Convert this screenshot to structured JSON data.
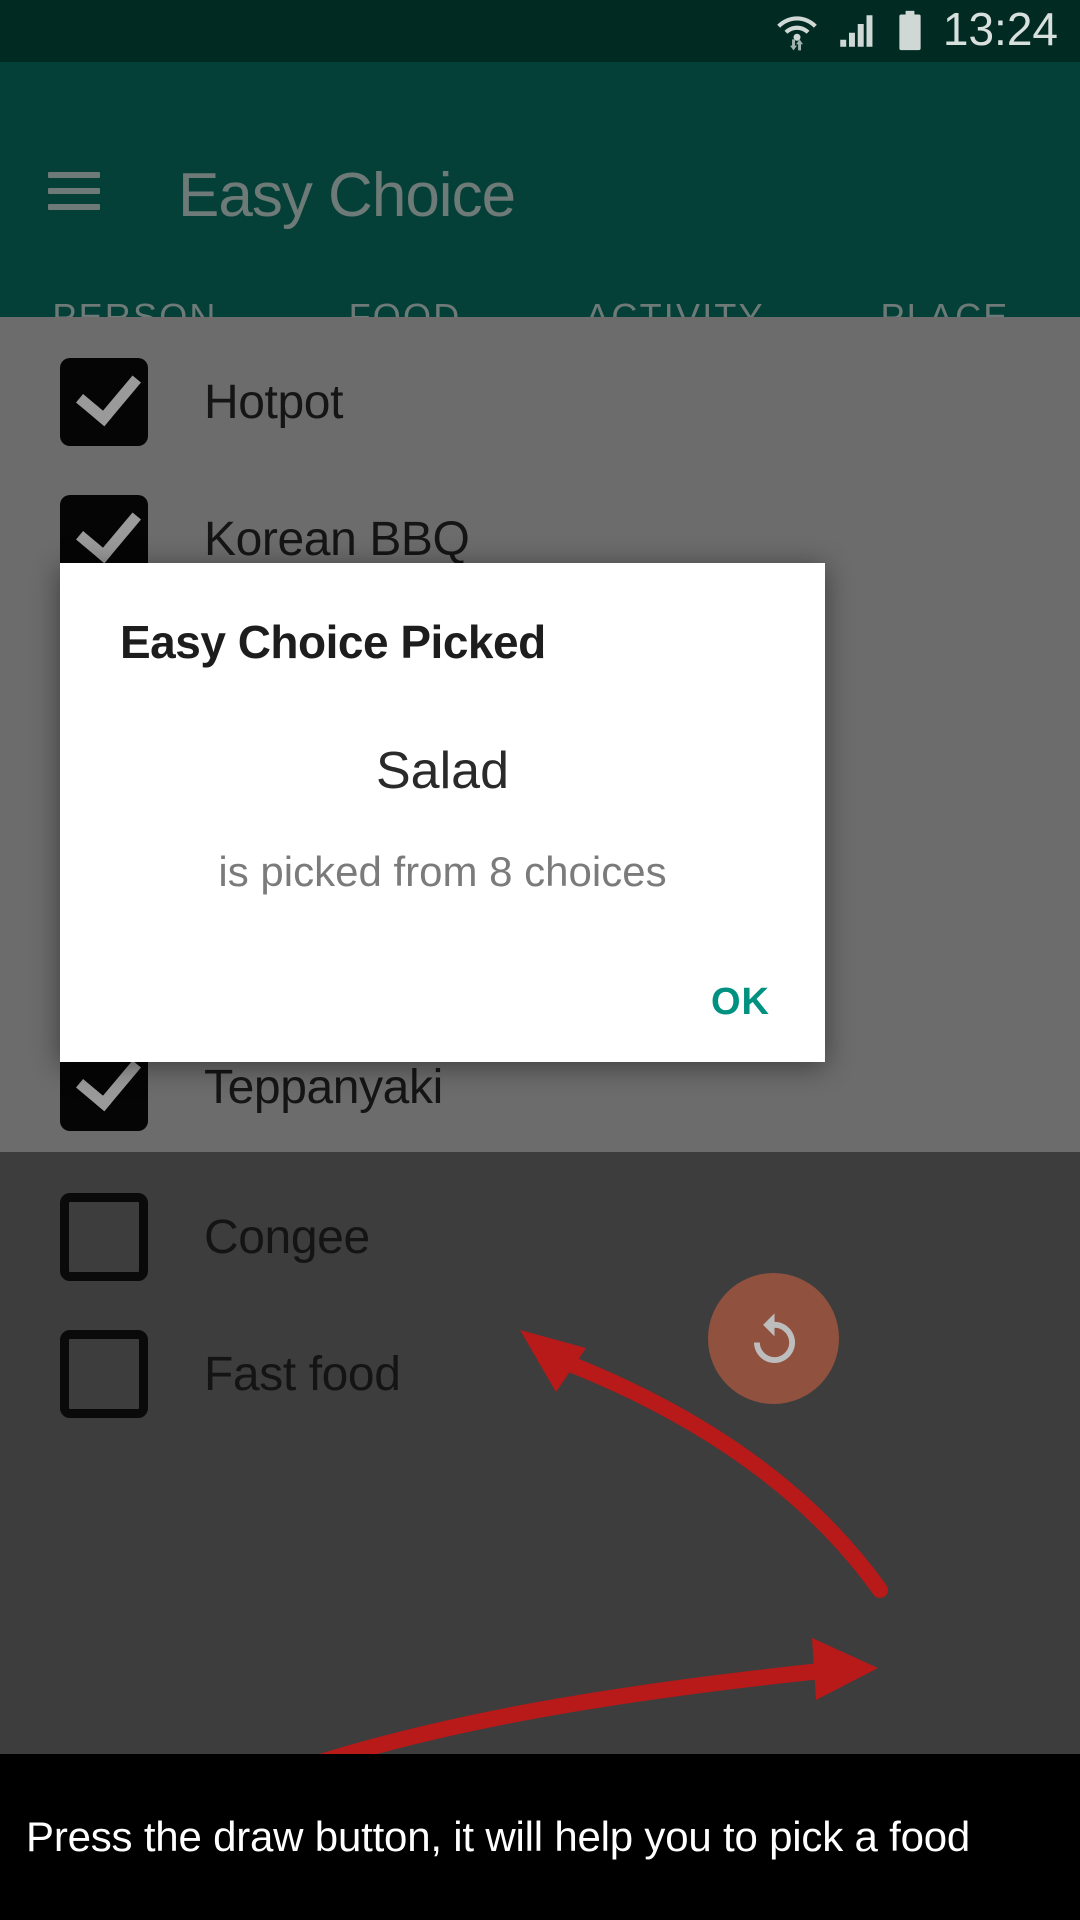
{
  "status_bar": {
    "time": "13:24",
    "icons": [
      "wifi-icon",
      "signal-icon",
      "battery-icon"
    ]
  },
  "app_bar": {
    "menu_icon": "hamburger-menu-icon",
    "title": "Easy Choice"
  },
  "tabs": {
    "items": [
      {
        "label": "PERSON",
        "active": false
      },
      {
        "label": "FOOD",
        "active": true
      },
      {
        "label": "ACTIVITY",
        "active": false
      },
      {
        "label": "PLACE",
        "active": false
      }
    ],
    "indicator_color": "#a8503a"
  },
  "list": {
    "items": [
      {
        "label": "Hotpot",
        "checked": true
      },
      {
        "label": "Korean BBQ",
        "checked": true
      },
      {
        "label": "",
        "checked": true
      },
      {
        "label": "",
        "checked": true
      },
      {
        "label": "",
        "checked": true
      },
      {
        "label": "Teppanyaki",
        "checked": true
      },
      {
        "label": "Congee",
        "checked": false
      },
      {
        "label": "Fast food",
        "checked": false
      }
    ]
  },
  "dialog": {
    "title": "Easy Choice Picked",
    "picked_value": "Salad",
    "subtitle": "is picked from 8 choices",
    "ok_label": "OK",
    "ok_color": "#009180"
  },
  "fab": {
    "icon": "rotate-left-refresh-icon",
    "color": "#90513f"
  },
  "caption": {
    "text": "Press the draw button, it will help you to pick a food"
  },
  "theme": {
    "status_bar_bg": "#012a23",
    "app_bar_bg": "#054038",
    "scrim_bg": "#6c6c6c",
    "dark_band_bg": "#3d3d3d",
    "arrow_color": "#b81919"
  }
}
